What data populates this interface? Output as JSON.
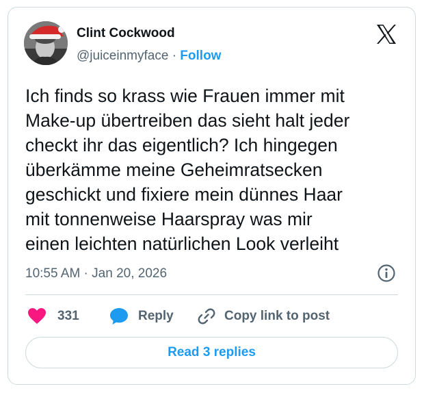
{
  "author": {
    "name": "Clint Cockwood",
    "handle": "@juiceinmyface",
    "separator": "·",
    "follow_label": "Follow"
  },
  "tweet": {
    "text": "Ich finds so krass wie Frauen immer mit\nMake-up übertreiben das sieht halt jeder\ncheckt ihr das eigentlich? Ich hingegen\nüberkämme meine Geheimratsecken\ngeschickt und fixiere mein dünnes Haar\nmit tonnenweise Haarspray was mir\neinen leichten natürlichen Look verleiht",
    "timestamp": "10:55 AM · Jan 20, 2026"
  },
  "actions": {
    "like_count": "331",
    "reply_label": "Reply",
    "copy_label": "Copy link to post"
  },
  "replies_button": "Read 3 replies",
  "icons": {
    "logo": "x-logo-icon",
    "info": "info-icon",
    "like": "heart-icon",
    "reply": "speech-bubble-icon",
    "copy": "link-icon",
    "avatar_hat": "santa-hat"
  },
  "colors": {
    "accent": "#1d9bf0",
    "like": "#f91880",
    "text": "#0f1419",
    "secondary": "#536471",
    "border": "#cfd9de"
  }
}
